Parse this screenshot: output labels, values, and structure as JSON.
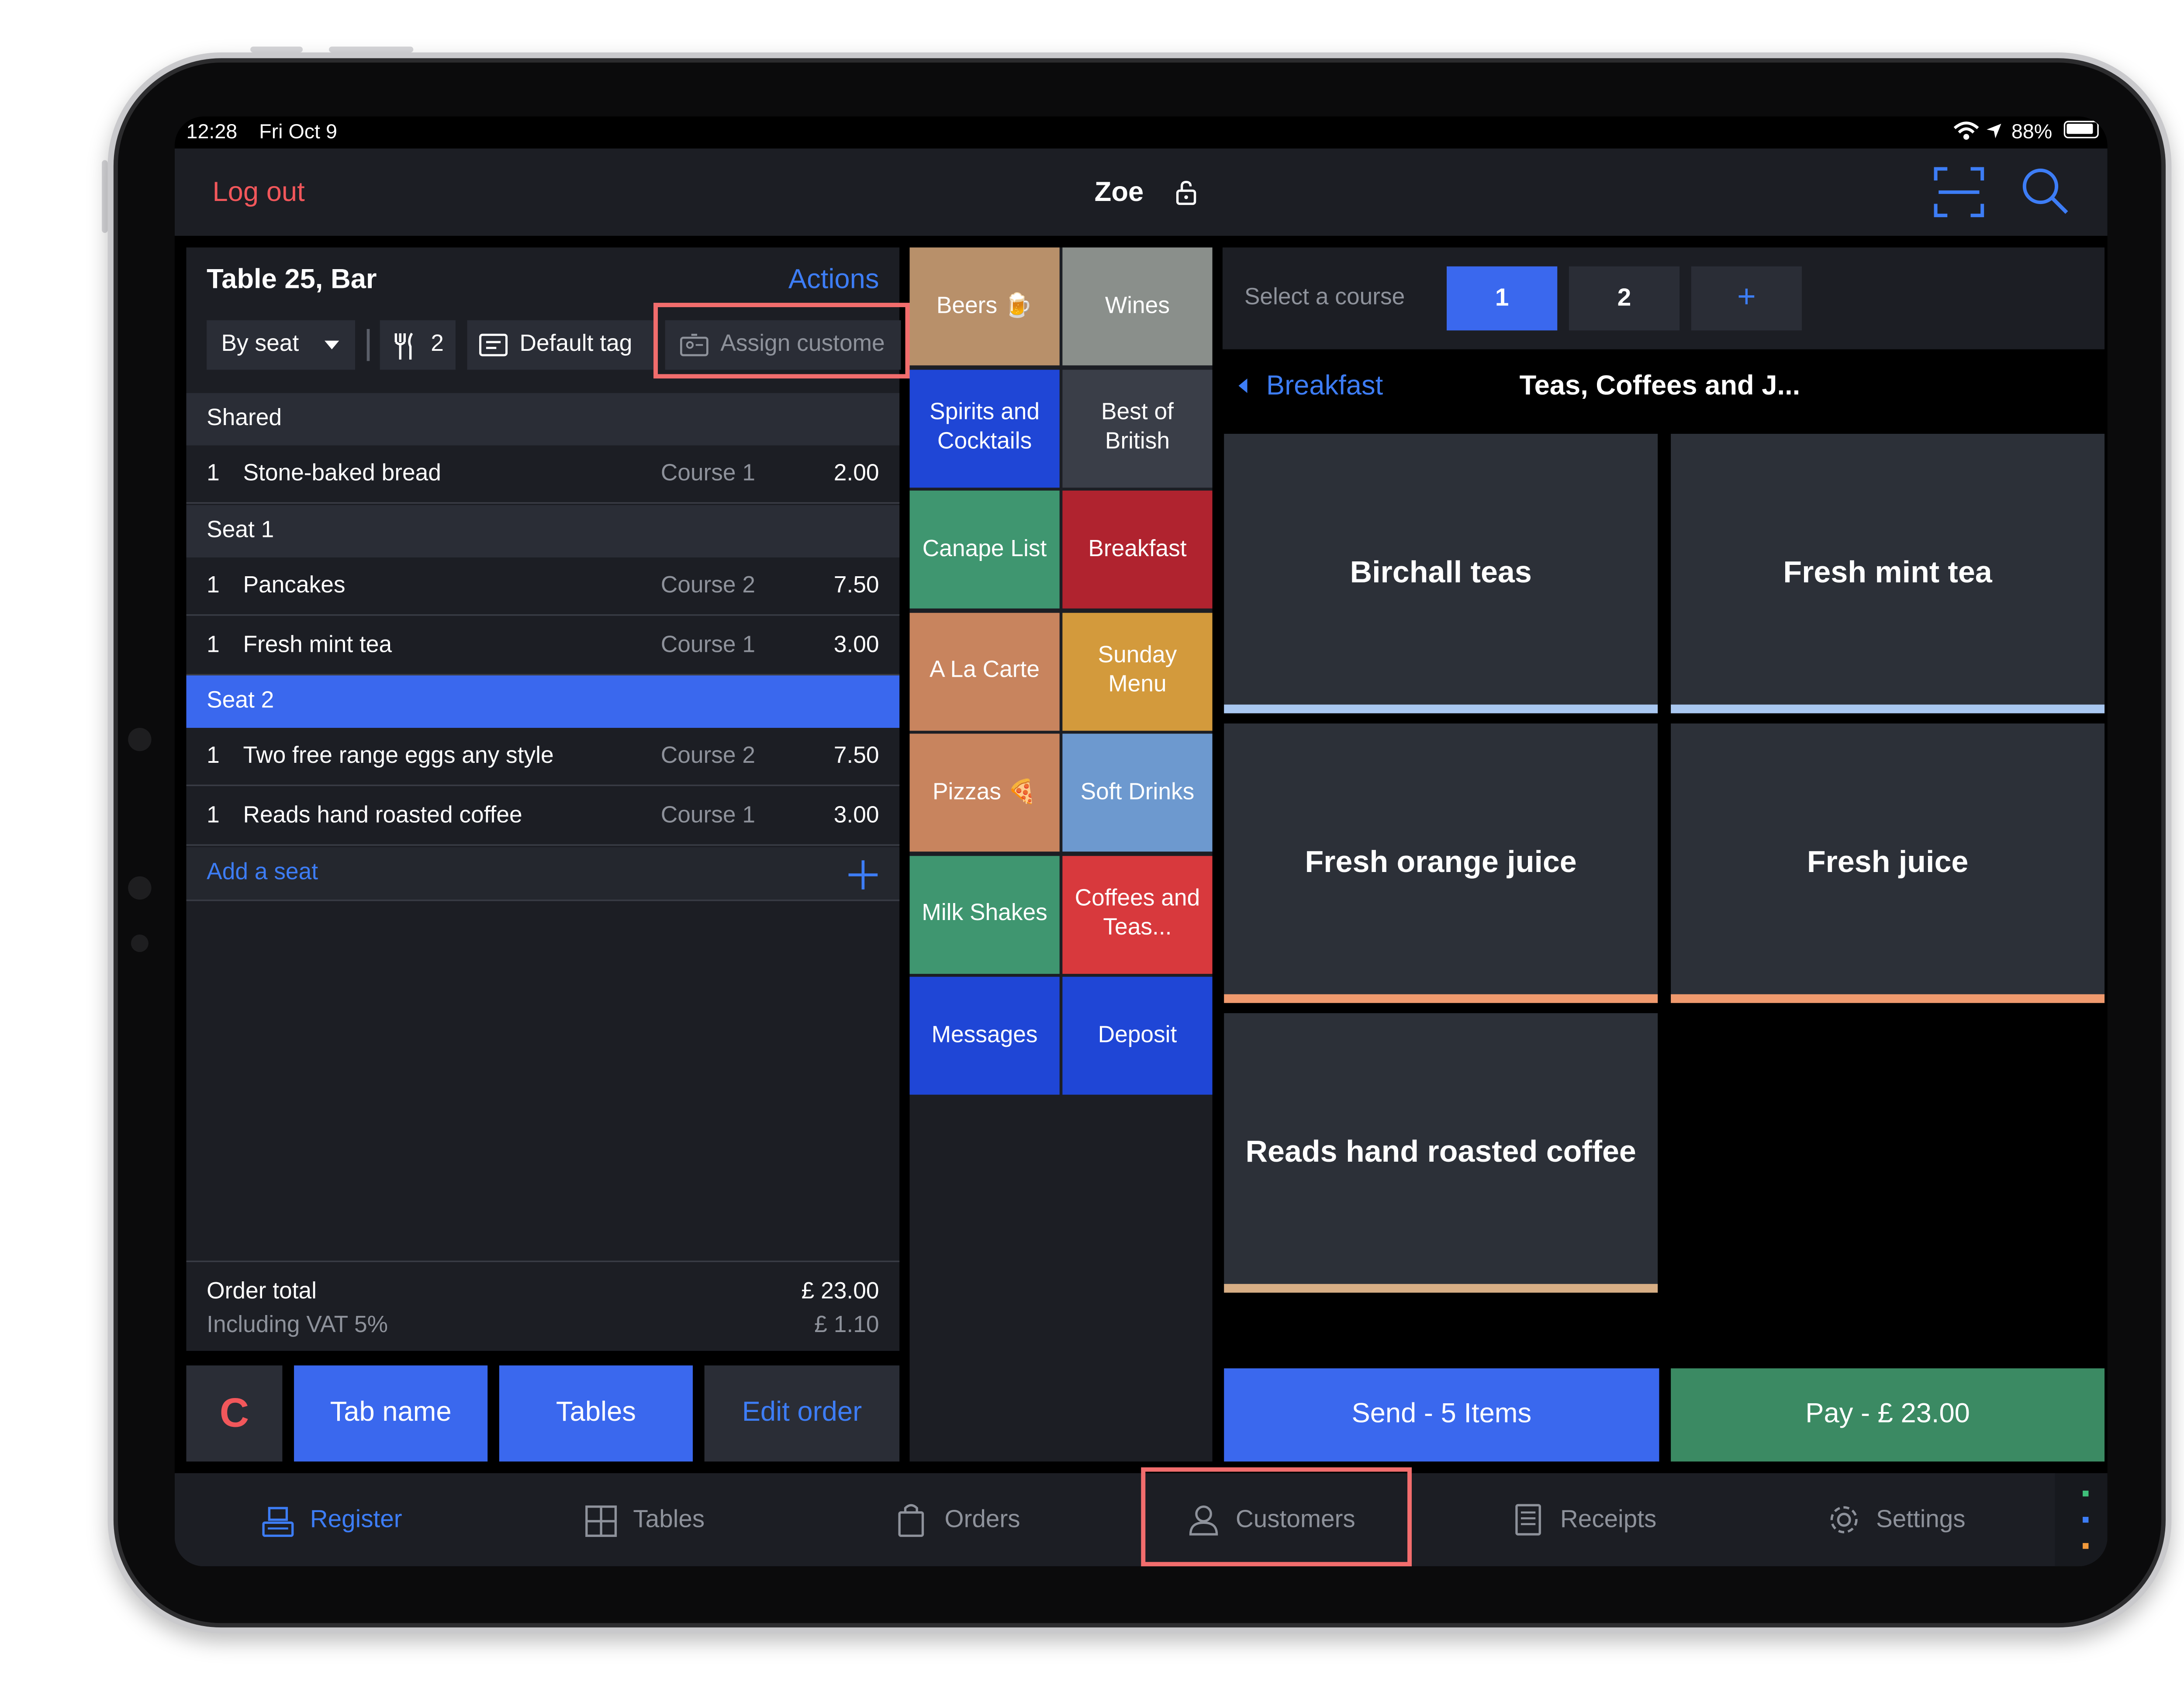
{
  "status_bar": {
    "time": "12:28",
    "date": "Fri Oct 9",
    "battery": "88%"
  },
  "header": {
    "logout_label": "Log out",
    "user_name": "Zoe"
  },
  "order": {
    "title": "Table 25, Bar",
    "actions_label": "Actions",
    "toolbar": {
      "group_by": "By seat",
      "covers": "2",
      "tag": "Default tag",
      "assign_customer": "Assign custome"
    },
    "sections": [
      {
        "label": "Shared",
        "items": [
          {
            "qty": "1",
            "name": "Stone-baked bread",
            "course": "Course 1",
            "price": "2.00"
          }
        ]
      },
      {
        "label": "Seat 1",
        "items": [
          {
            "qty": "1",
            "name": "Pancakes",
            "course": "Course 2",
            "price": "7.50"
          },
          {
            "qty": "1",
            "name": "Fresh mint tea",
            "course": "Course 1",
            "price": "3.00"
          }
        ]
      },
      {
        "label": "Seat 2",
        "items": [
          {
            "qty": "1",
            "name": "Two free range eggs any style",
            "course": "Course 2",
            "price": "7.50"
          },
          {
            "qty": "1",
            "name": "Reads hand roasted coffee",
            "course": "Course 1",
            "price": "3.00"
          }
        ]
      }
    ],
    "add_seat_label": "Add a seat",
    "total_label": "Order total",
    "total_value": "£ 23.00",
    "vat_label": "Including VAT 5%",
    "vat_value": "£ 1.10"
  },
  "order_buttons": {
    "clear": "C",
    "tab_name": "Tab name",
    "tables": "Tables",
    "edit_order": "Edit order"
  },
  "categories": [
    {
      "label": "Beers 🍺",
      "color": "#b8906a"
    },
    {
      "label": "Wines",
      "color": "#8a8f8b"
    },
    {
      "label": "Spirits and Cocktails",
      "color": "#1f46d6"
    },
    {
      "label": "Best of British",
      "color": "#3a3e48"
    },
    {
      "label": "Canape List",
      "color": "#3f9670"
    },
    {
      "label": "Breakfast",
      "color": "#b0232f"
    },
    {
      "label": "A La Carte",
      "color": "#c8845e"
    },
    {
      "label": "Sunday Menu",
      "color": "#d39a3c"
    },
    {
      "label": "Pizzas 🍕",
      "color": "#c8845e"
    },
    {
      "label": "Soft Drinks",
      "color": "#6d99cf"
    },
    {
      "label": "Milk Shakes",
      "color": "#3f9670"
    },
    {
      "label": "Coffees and Teas...",
      "color": "#d8393d"
    },
    {
      "label": "Messages",
      "color": "#1f46d6"
    },
    {
      "label": "Deposit",
      "color": "#1f46d6"
    }
  ],
  "courses": {
    "label": "Select a course",
    "options": [
      "1",
      "2"
    ],
    "add": "+"
  },
  "breadcrumb": {
    "back": "Breakfast",
    "title": "Teas, Coffees and J..."
  },
  "products": [
    {
      "label": "Birchall teas",
      "accent": "#a9c7f0"
    },
    {
      "label": "Fresh mint tea",
      "accent": "#a9c7f0"
    },
    {
      "label": "Fresh orange juice",
      "accent": "#f09a6e"
    },
    {
      "label": "Fresh juice",
      "accent": "#f09a6e"
    },
    {
      "label": "Reads hand roasted coffee",
      "accent": "#d7ae85"
    }
  ],
  "checkout": {
    "send": "Send - 5 Items",
    "pay": "Pay - £ 23.00"
  },
  "tabs": [
    {
      "label": "Register",
      "icon": "register-icon",
      "active": true
    },
    {
      "label": "Tables",
      "icon": "tables-icon"
    },
    {
      "label": "Orders",
      "icon": "orders-icon"
    },
    {
      "label": "Customers",
      "icon": "customers-icon"
    },
    {
      "label": "Receipts",
      "icon": "receipts-icon"
    },
    {
      "label": "Settings",
      "icon": "settings-icon"
    }
  ],
  "colors": {
    "accent": "#3d7df6",
    "danger": "#f2575b",
    "pay": "#3b8a63",
    "highlight": "#f26d6d"
  }
}
